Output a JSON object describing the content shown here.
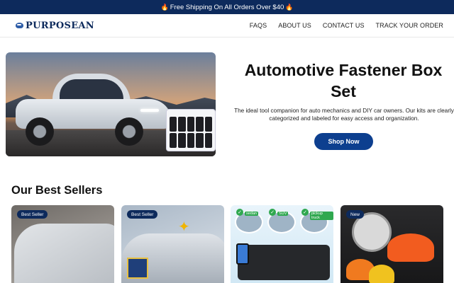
{
  "announcement": {
    "text": "Free Shipping On All Orders Over $40"
  },
  "header": {
    "logo": "PURPOSEAN",
    "nav": [
      {
        "label": "FAQS"
      },
      {
        "label": "ABOUT US"
      },
      {
        "label": "CONTACT US"
      },
      {
        "label": "TRACK YOUR ORDER"
      }
    ]
  },
  "hero": {
    "title": "Automotive Fastener Box Set",
    "description": "The ideal tool companion for auto mechanics and DIY car owners. Our kits are clearly categorized and labeled for easy access and organization.",
    "button": "Shop Now"
  },
  "bestsellers": {
    "title": "Our Best Sellers",
    "products": [
      {
        "badge": "Best Seller"
      },
      {
        "badge": "Best Seller"
      },
      {
        "badge": "",
        "thumb_labels": [
          "sedan",
          "SUV",
          "pickup truck"
        ]
      },
      {
        "badge": "New"
      }
    ]
  },
  "colors": {
    "navy": "#0d2a5c",
    "button": "#0d3f8f",
    "accent_flame": "#ff7a1a"
  },
  "icons": [
    "flame-icon",
    "logo-icon",
    "check-icon"
  ]
}
